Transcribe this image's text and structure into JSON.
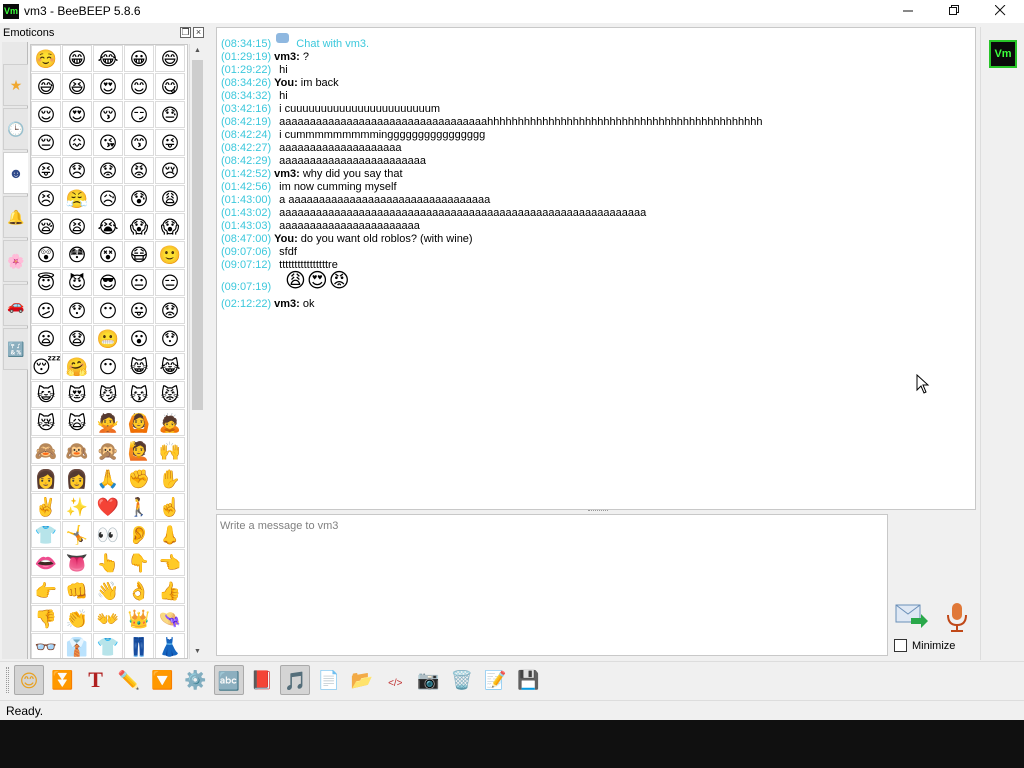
{
  "window": {
    "app_logo": "Vm",
    "title": "vm3 - BeeBEEP 5.8.6",
    "controls": {
      "minimize": "minimize-icon",
      "restore": "restore-icon",
      "close": "close-icon"
    }
  },
  "emoticons_dock": {
    "title": "Emoticons",
    "float_button": "float-icon",
    "close_button": "close-icon",
    "categories": [
      {
        "name": "favorites",
        "glyph": "★",
        "color": "#f0a830"
      },
      {
        "name": "recent",
        "glyph": "🕒",
        "color": "#6a8cb0"
      },
      {
        "name": "people",
        "glyph": "☻",
        "color": "#304a8a"
      },
      {
        "name": "objects",
        "glyph": "🔔",
        "color": "#b08020"
      },
      {
        "name": "nature",
        "glyph": "🌸",
        "color": "#e05080"
      },
      {
        "name": "places",
        "glyph": "🚗",
        "color": "#c03030"
      },
      {
        "name": "symbols",
        "glyph": "🔣",
        "color": "#4060a0"
      }
    ],
    "emojis": [
      "☺️",
      "😁",
      "😂",
      "😀",
      "😄",
      "😅",
      "😆",
      "😍",
      "😊",
      "😋",
      "😌",
      "😍",
      "😚",
      "😏",
      "😓",
      "😔",
      "😖",
      "😘",
      "😙",
      "😜",
      "😝",
      "😞",
      "😟",
      "😡",
      "😢",
      "😣",
      "😤",
      "😥",
      "😰",
      "😩",
      "😪",
      "😫",
      "😭",
      "😱",
      "😱",
      "😲",
      "😳",
      "😵",
      "😷",
      "🙂",
      "😇",
      "😈",
      "😎",
      "😐",
      "😑",
      "😕",
      "😯",
      "😶",
      "😛",
      "😟",
      "😦",
      "😧",
      "😬",
      "😮",
      "😯",
      "😴",
      "🤗",
      "😶",
      "😸",
      "😹",
      "😺",
      "😻",
      "😼",
      "😽",
      "😾",
      "😿",
      "🙀",
      "🙅",
      "🙆",
      "🙇",
      "🙈",
      "🙉",
      "🙊",
      "🙋",
      "🙌",
      "👩",
      "👩",
      "🙏",
      "✊",
      "✋",
      "✌️",
      "✨",
      "❤️",
      "🚶",
      "☝️",
      "👕",
      "🤸",
      "👀",
      "👂",
      "👃",
      "👄",
      "👅",
      "👆",
      "👇",
      "👈",
      "👉",
      "👊",
      "👋",
      "👌",
      "👍",
      "👎",
      "👏",
      "👐",
      "👑",
      "👒",
      "👓",
      "👔",
      "👕",
      "👖",
      "👗"
    ],
    "scroll": {
      "up": "scroll-up-icon",
      "down": "scroll-down-icon"
    }
  },
  "chat": {
    "header": {
      "time": "(08:34:15)",
      "text": "Chat with vm3."
    },
    "messages": [
      {
        "time": "(01:29:19)",
        "sender": "vm3:",
        "text": "?"
      },
      {
        "time": "(01:29:22)",
        "sender": "",
        "text": "hi"
      },
      {
        "time": "(08:34:26)",
        "sender": "You:",
        "text": "im back"
      },
      {
        "time": "(08:34:32)",
        "sender": "",
        "text": "hi"
      },
      {
        "time": "(03:42:16)",
        "sender": "",
        "text": "i cuuuuuuuuuuuuuuuuuuuuuuum"
      },
      {
        "time": "(08:42:19)",
        "sender": "",
        "text": "aaaaaaaaaaaaaaaaaaaaaaaaaaaaaaaaaahhhhhhhhhhhhhhhhhhhhhhhhhhhhhhhhhhhhhhhhhhhhh"
      },
      {
        "time": "(08:42:24)",
        "sender": "",
        "text": "i cummmmmmmmmingggggggggggggggg"
      },
      {
        "time": "(08:42:27)",
        "sender": "",
        "text": "aaaaaaaaaaaaaaaaaaaa"
      },
      {
        "time": "(08:42:29)",
        "sender": "",
        "text": "aaaaaaaaaaaaaaaaaaaaaaaa"
      },
      {
        "time": "(01:42:52)",
        "sender": "vm3:",
        "text": "why did you say that"
      },
      {
        "time": "(01:42:56)",
        "sender": "",
        "text": "im now cumming myself"
      },
      {
        "time": "(01:43:00)",
        "sender": "",
        "text": "a aaaaaaaaaaaaaaaaaaaaaaaaaaaaaaaaa"
      },
      {
        "time": "(01:43:02)",
        "sender": "",
        "text": "aaaaaaaaaaaaaaaaaaaaaaaaaaaaaaaaaaaaaaaaaaaaaaaaaaaaaaaaaaaa"
      },
      {
        "time": "(01:43:03)",
        "sender": "",
        "text": "aaaaaaaaaaaaaaaaaaaaaaa"
      },
      {
        "time": "(08:47:00)",
        "sender": "You:",
        "text": "do you want old roblos? (with wine)"
      },
      {
        "time": "(09:07:06)",
        "sender": "",
        "text": "sfdf"
      },
      {
        "time": "(09:07:12)",
        "sender": "",
        "text": "ttttttttttttttttre"
      }
    ],
    "emoji_message": {
      "time": "(09:07:19)",
      "emojis": "😩😍😡"
    },
    "last_message": {
      "time": "(02:12:22)",
      "sender": "vm3:",
      "text": "ok"
    }
  },
  "compose": {
    "placeholder": "Write a message to vm3",
    "value": "",
    "send_icon": "send-icon",
    "mic_icon": "microphone-icon",
    "minimize_label": "Minimize",
    "minimize_checked": false
  },
  "user_panel": {
    "avatar_label": "Vm",
    "avatar_color": "#27c427"
  },
  "toolbar": {
    "tools": [
      {
        "name": "emoticons",
        "glyph": "😊",
        "active": true
      },
      {
        "name": "hide-panel",
        "glyph": "⏬",
        "active": false
      },
      {
        "name": "font",
        "glyph": "T",
        "active": false
      },
      {
        "name": "color",
        "glyph": "✏️",
        "active": false
      },
      {
        "name": "filter",
        "glyph": "🔽",
        "active": false
      },
      {
        "name": "settings",
        "glyph": "⚙️",
        "active": false
      },
      {
        "name": "spellcheck",
        "glyph": "🔤",
        "active": true
      },
      {
        "name": "dictionary",
        "glyph": "📕",
        "active": false
      },
      {
        "name": "sound",
        "glyph": "🎵",
        "active": true
      },
      {
        "name": "send-file",
        "glyph": "📄",
        "active": false
      },
      {
        "name": "send-folder",
        "glyph": "📂",
        "active": false
      },
      {
        "name": "html-code",
        "glyph": "</>",
        "active": false
      },
      {
        "name": "screenshot",
        "glyph": "📷",
        "active": false
      },
      {
        "name": "clear-chat",
        "glyph": "🗑️",
        "active": false
      },
      {
        "name": "edit",
        "glyph": "📝",
        "active": false
      },
      {
        "name": "save-chat",
        "glyph": "💾",
        "active": false
      }
    ]
  },
  "status": {
    "text": "Ready."
  }
}
